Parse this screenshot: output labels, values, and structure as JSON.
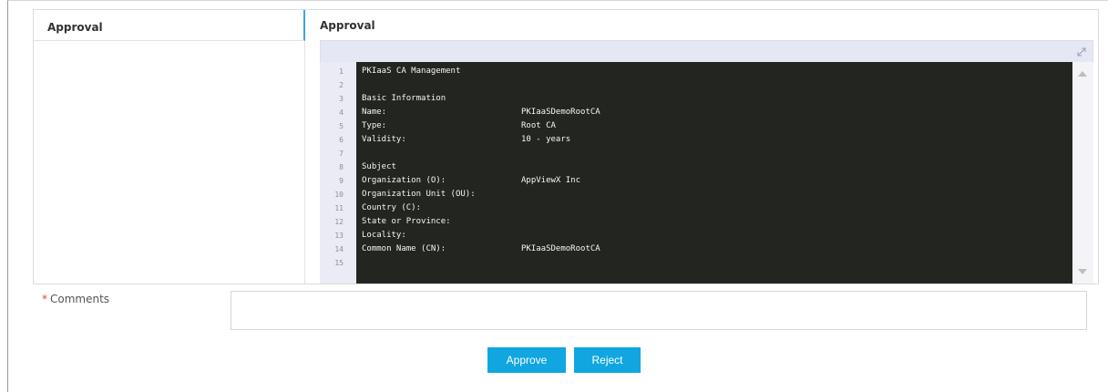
{
  "sidebar": {
    "title": "Approval"
  },
  "main": {
    "title": "Approval"
  },
  "editor": {
    "lines": [
      {
        "num": "1",
        "text": "PKIaaS CA Management",
        "value": ""
      },
      {
        "num": "2",
        "text": "",
        "value": ""
      },
      {
        "num": "3",
        "text": "Basic Information",
        "value": ""
      },
      {
        "num": "4",
        "text": "Name:",
        "value": "PKIaaSDemoRootCA"
      },
      {
        "num": "5",
        "text": "Type:",
        "value": "Root CA"
      },
      {
        "num": "6",
        "text": "Validity:",
        "value": "10 - years"
      },
      {
        "num": "7",
        "text": "",
        "value": ""
      },
      {
        "num": "8",
        "text": "Subject",
        "value": ""
      },
      {
        "num": "9",
        "text": "Organization (O):",
        "value": "AppViewX Inc"
      },
      {
        "num": "10",
        "text": "Organization Unit (OU):",
        "value": ""
      },
      {
        "num": "11",
        "text": "Country (C):",
        "value": ""
      },
      {
        "num": "12",
        "text": "State or Province:",
        "value": ""
      },
      {
        "num": "13",
        "text": "Locality:",
        "value": ""
      },
      {
        "num": "14",
        "text": "Common Name (CN):",
        "value": "PKIaaSDemoRootCA"
      },
      {
        "num": "15",
        "text": "",
        "value": ""
      }
    ]
  },
  "comments": {
    "required_mark": "*",
    "label": "Comments",
    "value": ""
  },
  "actions": {
    "approve_label": "Approve",
    "reject_label": "Reject"
  },
  "colors": {
    "accent": "#11a6e0",
    "editor_bg": "#232620",
    "toolbar_bg": "#e6e7f4",
    "required": "#e0463a"
  }
}
